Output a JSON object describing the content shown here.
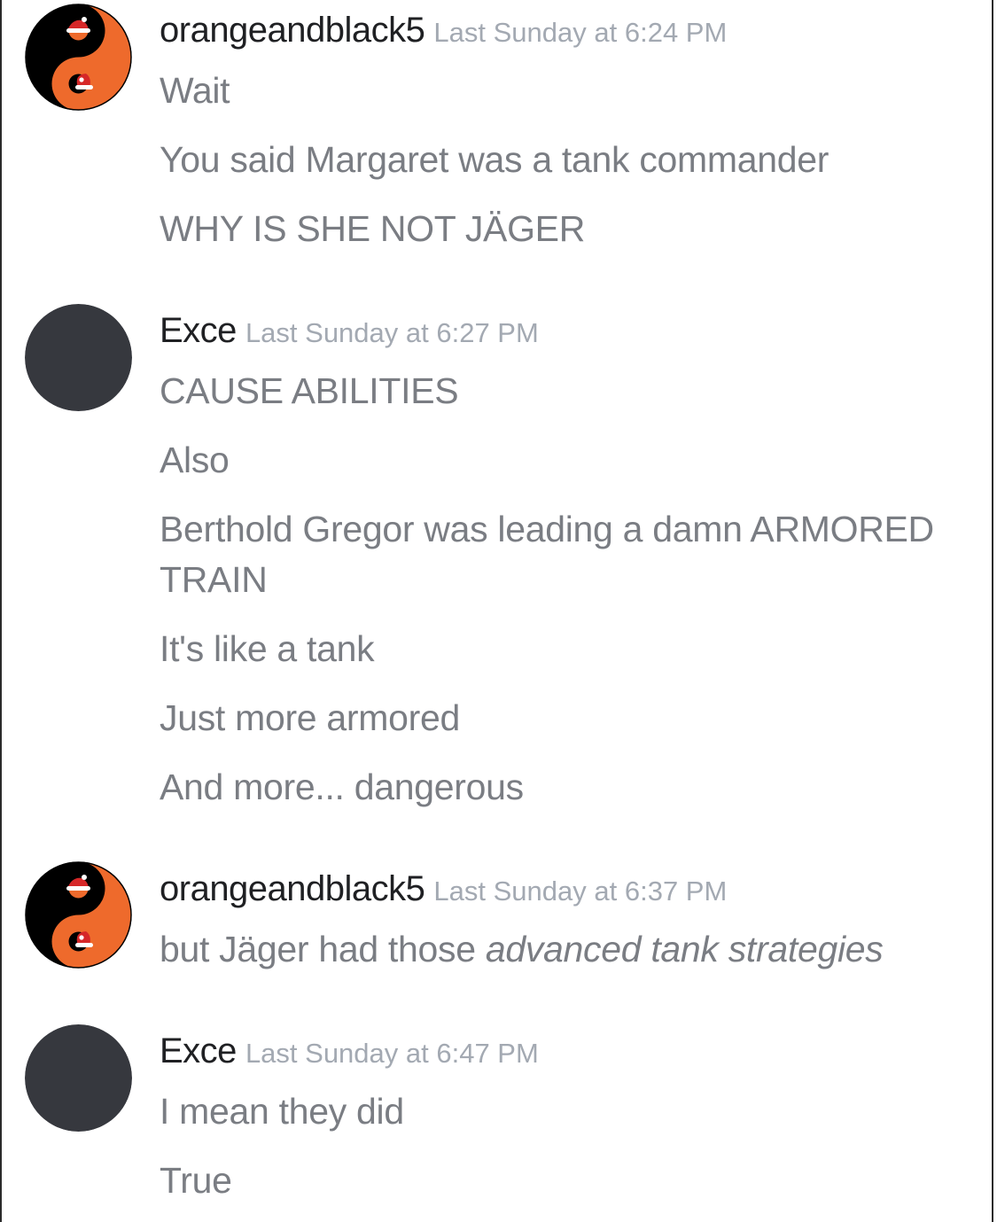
{
  "colors": {
    "username": "#1f2023",
    "timestamp": "#a3a9b2",
    "message_text": "#7a7d83",
    "avatar_dark": "#36383e",
    "avatar_orange": "#ee6a2c",
    "avatar_black": "#000000"
  },
  "groups": [
    {
      "author": "orangeandblack5",
      "timestamp": "Last Sunday at 6:24 PM",
      "avatar_icon": "yin-yang-santa-hat-icon",
      "messages": [
        "Wait",
        "You said Margaret was a tank commander",
        "WHY IS SHE NOT JÄGER"
      ]
    },
    {
      "author": "Exce",
      "timestamp": "Last Sunday at 6:27 PM",
      "avatar_icon": "default-dark-avatar-icon",
      "messages": [
        "CAUSE ABILITIES",
        "Also",
        "Berthold Gregor was leading a damn ARMORED TRAIN",
        "It's like a tank",
        "Just more armored",
        "And more... dangerous"
      ]
    },
    {
      "author": "orangeandblack5",
      "timestamp": "Last Sunday at 6:37 PM",
      "avatar_icon": "yin-yang-santa-hat-icon",
      "messages": [
        {
          "plain": "but Jäger had those ",
          "italic": "advanced tank strategies"
        }
      ]
    },
    {
      "author": "Exce",
      "timestamp": "Last Sunday at 6:47 PM",
      "avatar_icon": "default-dark-avatar-icon",
      "messages": [
        "I mean they did",
        "True"
      ]
    }
  ]
}
